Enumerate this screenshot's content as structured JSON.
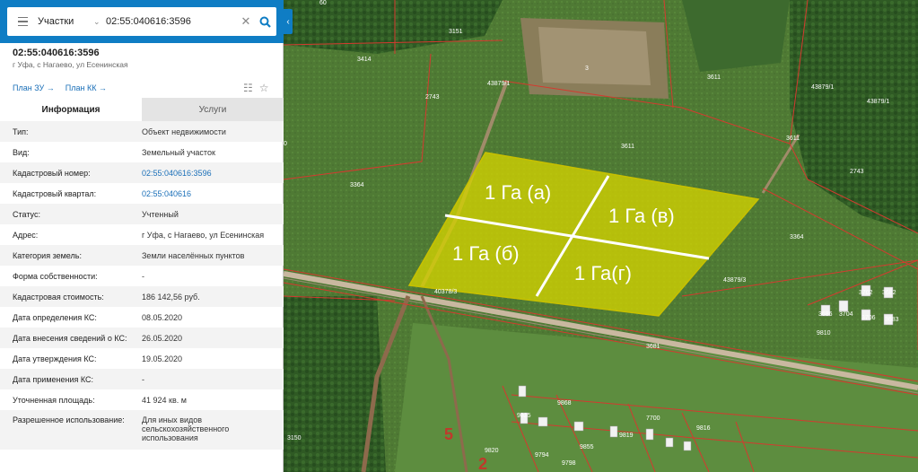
{
  "search": {
    "type_label": "Участки",
    "value": "02:55:040616:3596"
  },
  "object": {
    "cadastral_number": "02:55:040616:3596",
    "address_short": "г Уфа, с Нагаево, ул Есенинская"
  },
  "links": {
    "plan_zu": "План ЗУ →",
    "plan_kk": "План КК →"
  },
  "tabs": [
    {
      "label": "Информация",
      "active": true
    },
    {
      "label": "Услуги",
      "active": false
    }
  ],
  "rows": [
    {
      "label": "Тип:",
      "value": "Объект недвижимости"
    },
    {
      "label": "Вид:",
      "value": "Земельный участок"
    },
    {
      "label": "Кадастровый номер:",
      "value": "02:55:040616:3596",
      "link": true
    },
    {
      "label": "Кадастровый квартал:",
      "value": "02:55:040616",
      "link": true
    },
    {
      "label": "Статус:",
      "value": "Учтенный"
    },
    {
      "label": "Адрес:",
      "value": "г Уфа, с Нагаево, ул Есенинская"
    },
    {
      "label": "Категория земель:",
      "value": "Земли населённых пунктов"
    },
    {
      "label": "Форма собственности:",
      "value": "-"
    },
    {
      "label": "Кадастровая стоимость:",
      "value": "186 142,56 руб."
    },
    {
      "label": "Дата определения КС:",
      "value": "08.05.2020"
    },
    {
      "label": "Дата внесения сведений о КС:",
      "value": "26.05.2020"
    },
    {
      "label": "Дата утверждения КС:",
      "value": "19.05.2020"
    },
    {
      "label": "Дата применения КС:",
      "value": "-"
    },
    {
      "label": "Уточненная площадь:",
      "value": "41 924 кв. м"
    },
    {
      "label": "Разрешенное использование:",
      "value": "Для иных видов сельскохозяйственного использования"
    }
  ],
  "map": {
    "plots": [
      "1 Га (а)",
      "1 Га (в)",
      "1 Га (б)",
      "1 Га(г)"
    ],
    "parcel_labels": [
      "3151",
      "3414",
      "3",
      "43879/1",
      "2743",
      "3611",
      "3611",
      "3611",
      "43879/1",
      "43879/1",
      "2743",
      "3364",
      "3364",
      "43879/3",
      "40378/3",
      "3681",
      "3702",
      "3682",
      "3686",
      "3704",
      "3706",
      "3683",
      "9810",
      "9868",
      "7700",
      "9816",
      "9835",
      "9855",
      "9819",
      "9820",
      "9794",
      "9798",
      "2",
      "5",
      "3150",
      "60",
      "0"
    ]
  },
  "colors": {
    "accent": "#0f7dc4",
    "plot_fill": "#d4d200",
    "boundary": "#c0392b"
  }
}
